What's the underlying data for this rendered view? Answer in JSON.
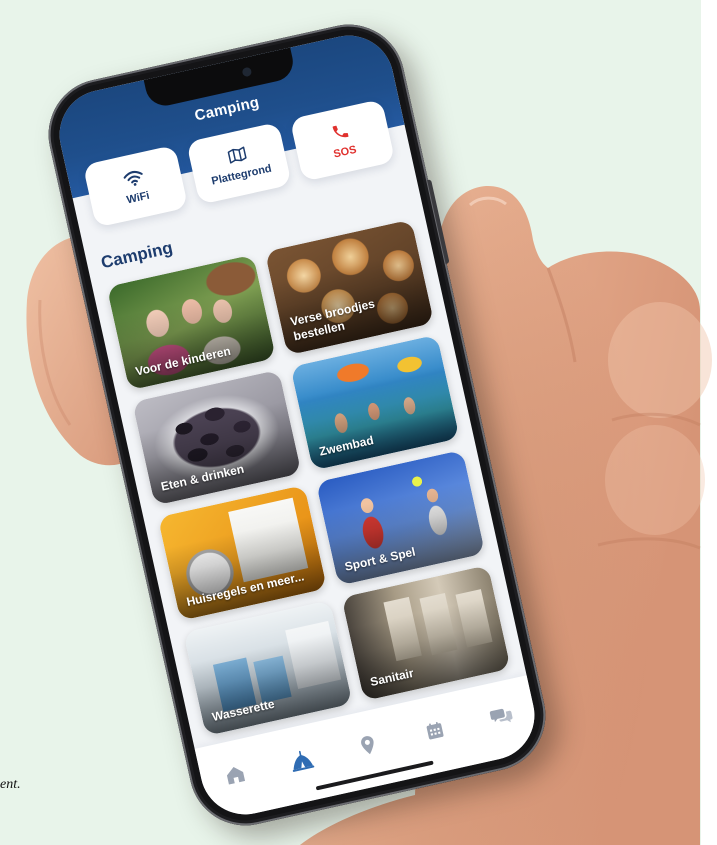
{
  "app": {
    "title": "Camping"
  },
  "quick_actions": [
    {
      "label": "WiFi",
      "icon": "wifi-icon"
    },
    {
      "label": "Plattegrond",
      "icon": "map-icon"
    },
    {
      "label": "SOS",
      "icon": "phone-icon"
    }
  ],
  "section": {
    "title": "Camping"
  },
  "tiles": [
    {
      "label": "Voor de kinderen"
    },
    {
      "label": "Verse broodjes bestellen"
    },
    {
      "label": "Eten & drinken"
    },
    {
      "label": "Zwembad"
    },
    {
      "label": "Huisregels en meer..."
    },
    {
      "label": "Sport & Spel"
    },
    {
      "label": "Wasserette"
    },
    {
      "label": "Sanitair"
    }
  ],
  "bottom_nav": {
    "items": [
      {
        "icon": "home-icon",
        "active": false
      },
      {
        "icon": "tent-icon",
        "active": true
      },
      {
        "icon": "location-pin-icon",
        "active": false
      },
      {
        "icon": "calendar-icon",
        "active": false
      },
      {
        "icon": "chat-icon",
        "active": false
      }
    ]
  },
  "caption": {
    "fragment": "ent."
  },
  "colors": {
    "header": "#1f4f8c",
    "accent": "#2f6cb3",
    "sos": "#e0312e",
    "title": "#1d3c6e",
    "background": "#e8f4ea"
  }
}
